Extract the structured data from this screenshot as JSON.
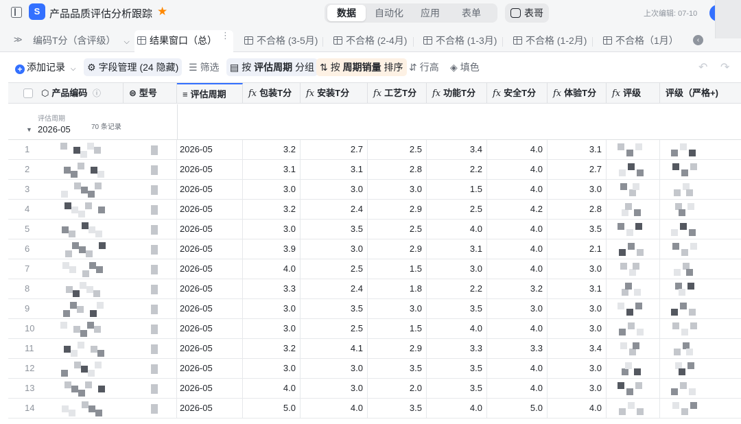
{
  "app": {
    "logo_glyph": "S",
    "title": "产品品质评估分析跟踪",
    "mode_tabs": [
      "数据",
      "自动化",
      "应用",
      "表单"
    ],
    "active_mode": "数据",
    "assistant_label": "表哥",
    "last_edit": "上次编辑: 07-10"
  },
  "tabs": {
    "expand_icon": "chevrons-right-icon",
    "items": [
      {
        "label": "编码T分（含评级）",
        "type": "dropdown"
      },
      {
        "label": "结果窗口（总）",
        "type": "grid",
        "active": true
      },
      {
        "label": "不合格 (3-5月)",
        "type": "grid"
      },
      {
        "label": "不合格 (2-4月)",
        "type": "grid"
      },
      {
        "label": "不合格 (1-3月)",
        "type": "grid"
      },
      {
        "label": "不合格 (1-2月)",
        "type": "grid"
      },
      {
        "label": "不合格（1月）",
        "type": "grid"
      }
    ],
    "more": "⋮"
  },
  "toolbar": {
    "add_record": "添加记录",
    "field_manage": "字段管理 (24 隐藏)",
    "filter": "筛选",
    "group_prefix": "按",
    "group_field": "评估周期",
    "group_suffix": "分组",
    "sort_prefix": "按",
    "sort_field": "周期销量",
    "sort_suffix": "排序",
    "row_height": "行高",
    "fill_color": "填色"
  },
  "columns": [
    "产品编码",
    "型号",
    "评估周期",
    "包装T分",
    "安装T分",
    "工艺T分",
    "功能T分",
    "安全T分",
    "体验T分",
    "评级",
    "评级（严格+)"
  ],
  "group": {
    "field_label": "评估周期",
    "value": "2026-05",
    "count": "70 条记录"
  },
  "rows": [
    {
      "idx": "1",
      "period": "2026-05",
      "pack": "3.2",
      "install": "2.7",
      "craft": "2.5",
      "func": "3.4",
      "safety": "4.0",
      "exp": "3.1"
    },
    {
      "idx": "2",
      "period": "2026-05",
      "pack": "3.1",
      "install": "3.1",
      "craft": "2.8",
      "func": "2.2",
      "safety": "4.0",
      "exp": "2.7"
    },
    {
      "idx": "3",
      "period": "2026-05",
      "pack": "3.0",
      "install": "3.0",
      "craft": "3.0",
      "func": "1.5",
      "safety": "4.0",
      "exp": "3.0"
    },
    {
      "idx": "4",
      "period": "2026-05",
      "pack": "3.2",
      "install": "2.4",
      "craft": "2.9",
      "func": "2.5",
      "safety": "4.2",
      "exp": "2.8"
    },
    {
      "idx": "5",
      "period": "2026-05",
      "pack": "3.0",
      "install": "3.5",
      "craft": "2.5",
      "func": "4.0",
      "safety": "4.0",
      "exp": "3.5"
    },
    {
      "idx": "6",
      "period": "2026-05",
      "pack": "3.9",
      "install": "3.0",
      "craft": "2.9",
      "func": "3.1",
      "safety": "4.0",
      "exp": "2.1"
    },
    {
      "idx": "7",
      "period": "2026-05",
      "pack": "4.0",
      "install": "2.5",
      "craft": "1.5",
      "func": "3.0",
      "safety": "4.0",
      "exp": "3.0"
    },
    {
      "idx": "8",
      "period": "2026-05",
      "pack": "3.3",
      "install": "2.4",
      "craft": "1.8",
      "func": "2.2",
      "safety": "3.2",
      "exp": "3.1"
    },
    {
      "idx": "9",
      "period": "2026-05",
      "pack": "3.0",
      "install": "3.5",
      "craft": "3.0",
      "func": "3.5",
      "safety": "3.0",
      "exp": "3.0"
    },
    {
      "idx": "10",
      "period": "2026-05",
      "pack": "3.0",
      "install": "2.5",
      "craft": "1.5",
      "func": "4.0",
      "safety": "4.0",
      "exp": "3.0"
    },
    {
      "idx": "11",
      "period": "2026-05",
      "pack": "3.2",
      "install": "4.1",
      "craft": "2.9",
      "func": "3.3",
      "safety": "3.3",
      "exp": "3.4"
    },
    {
      "idx": "12",
      "period": "2026-05",
      "pack": "3.0",
      "install": "3.0",
      "craft": "3.5",
      "func": "3.5",
      "safety": "4.0",
      "exp": "3.0"
    },
    {
      "idx": "13",
      "period": "2026-05",
      "pack": "4.0",
      "install": "3.0",
      "craft": "2.0",
      "func": "3.5",
      "safety": "4.0",
      "exp": "3.0"
    },
    {
      "idx": "14",
      "period": "2026-05",
      "pack": "5.0",
      "install": "4.0",
      "craft": "3.5",
      "func": "4.0",
      "safety": "5.0",
      "exp": "4.0"
    }
  ],
  "colors": {
    "accent": "#3370ff",
    "star": "#ff8800",
    "header_bg": "#f5f6f7",
    "grid_line": "#dee0e3"
  }
}
